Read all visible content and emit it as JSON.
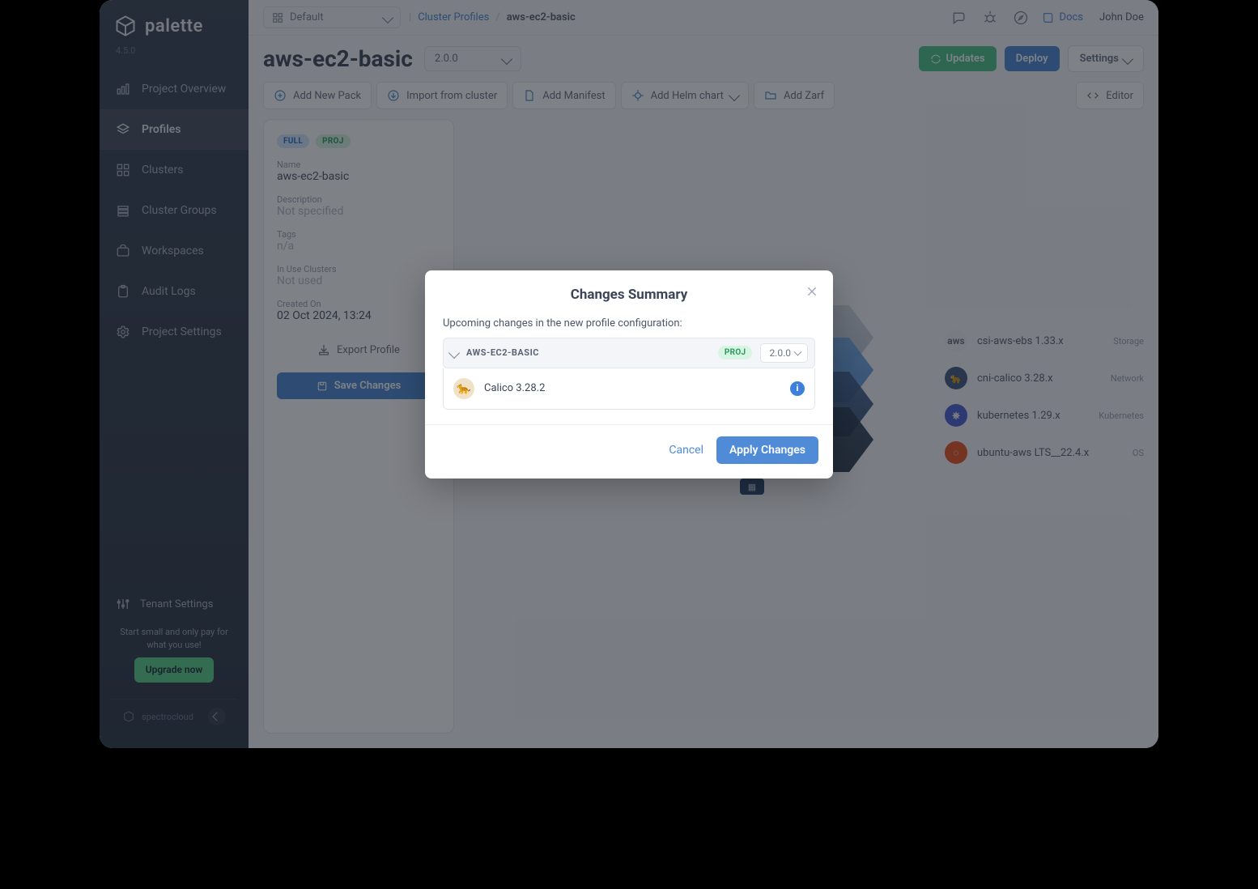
{
  "brand": {
    "name": "palette",
    "version": "4.5.0",
    "footer": "spectrocloud"
  },
  "sidebar": {
    "items": [
      {
        "label": "Project Overview"
      },
      {
        "label": "Profiles"
      },
      {
        "label": "Clusters"
      },
      {
        "label": "Cluster Groups"
      },
      {
        "label": "Workspaces"
      },
      {
        "label": "Audit Logs"
      },
      {
        "label": "Project Settings"
      }
    ],
    "tenant": "Tenant Settings",
    "upgrade_text": "Start small and only pay for what you use!",
    "upgrade_btn": "Upgrade now"
  },
  "topbar": {
    "project": "Default",
    "crumb_root": "Cluster Profiles",
    "crumb_current": "aws-ec2-basic",
    "docs": "Docs",
    "user": "John Doe"
  },
  "page": {
    "title": "aws-ec2-basic",
    "version": "2.0.0",
    "updates_btn": "Updates",
    "deploy_btn": "Deploy",
    "settings_btn": "Settings"
  },
  "toolbar": {
    "add_pack": "Add New Pack",
    "import": "Import from cluster",
    "manifest": "Add Manifest",
    "helm": "Add Helm chart",
    "zarf": "Add Zarf",
    "editor": "Editor"
  },
  "info": {
    "badge_full": "FULL",
    "badge_proj": "PROJ",
    "name_label": "Name",
    "name_value": "aws-ec2-basic",
    "desc_label": "Description",
    "desc_value": "Not specified",
    "tags_label": "Tags",
    "tags_value": "n/a",
    "inuse_label": "In Use Clusters",
    "inuse_value": "Not used",
    "created_label": "Created On",
    "created_value": "02 Oct 2024, 13:24",
    "export": "Export Profile",
    "save": "Save Changes"
  },
  "layers": [
    {
      "name": "csi-aws-ebs 1.33.x",
      "tag": "Storage"
    },
    {
      "name": "cni-calico 3.28.x",
      "tag": "Network"
    },
    {
      "name": "kubernetes 1.29.x",
      "tag": "Kubernetes"
    },
    {
      "name": "ubuntu-aws LTS__22.4.x",
      "tag": "OS"
    }
  ],
  "modal": {
    "title": "Changes Summary",
    "subtitle": "Upcoming changes in the new profile configuration:",
    "profile_name": "AWS-EC2-BASIC",
    "profile_badge": "PROJ",
    "profile_version": "2.0.0",
    "change_name": "Calico 3.28.2",
    "cancel": "Cancel",
    "apply": "Apply Changes"
  }
}
